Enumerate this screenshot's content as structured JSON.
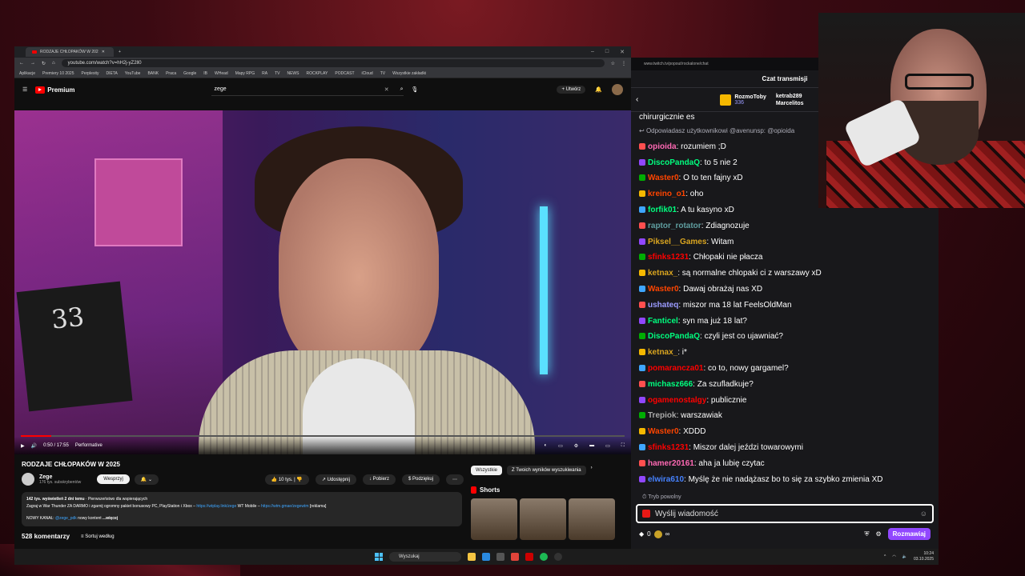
{
  "browser": {
    "tab_title": "RODZAJE CHŁOPAKÓW W 202",
    "url": "youtube.com/watch?v=hH2j-yZ2ll0",
    "bookmarks": [
      "Aplikacje",
      "Premiery 10 2025",
      "Perplexity",
      "DIETA",
      "YouTube",
      "BANK",
      "Praca",
      "Google",
      "IB",
      "WHead",
      "Mapy RPG",
      "RA",
      "TV",
      "NEWS",
      "ROCKPLAY",
      "PODCAST",
      "iCloud",
      "TV",
      "Wszystkie zakładki"
    ]
  },
  "youtube": {
    "logo_text": "Premium",
    "search_value": "zege",
    "create_label": "Utwórz",
    "player": {
      "time": "0:50 / 17:55",
      "chapter": "Performative",
      "progress": 0.05
    },
    "video_title": "RODZAJE CHŁOPAKÓW W 2025",
    "channel_name": "Zege",
    "channel_subs": "176 tys. subskrybentów",
    "support_label": "Wesprzyj",
    "likes": "10 tys.",
    "share_label": "Udostępnij",
    "download_label": "Pobierz",
    "thanks_label": "Podziękuj",
    "desc_stats": "142 tys. wyświetleń  2 dni temu",
    "desc_sponsor_note": "Pierwszeństwo dla wspierających",
    "desc_line1": "Zagraj w War Thunder ZA DARMO i zgarnij ogromny pakiet bonusowy PC, PlayStation i Xbox – ",
    "desc_link1": "https://wtplay.link/zege",
    "desc_line1b": "WT Mobile – ",
    "desc_link2": "https://wtm.gmae/zegewtm",
    "desc_line1c": " [reklama]",
    "desc_line2": "NOWY KANAŁ: ",
    "desc_link3": "@zege_pdk",
    "desc_line2b": " nowy kontent ",
    "desc_more": "...więcej",
    "comments_count": "528 komentarzy",
    "sort_label": "Sortuj według",
    "chip_all": "Wszystkie",
    "chip_results": "Z Twoich wyników wyszukiwania",
    "shorts_label": "Shorts"
  },
  "taskbar": {
    "search_placeholder": "Wyszukaj",
    "time": "10:24",
    "date": "03.10.2025"
  },
  "chat": {
    "popout_url": "www.twitch.tv/popout/rockalone/chat",
    "header": "Czat transmisji",
    "gift_user1": "RozmoToby",
    "gift_count1": "336",
    "gift_user2": "ketrab289",
    "gift_user3": "Marcelitos",
    "partial_msg": "chirurgicznie es",
    "reply_note": "Odpowiadasz użytkownikowi @avenunsp: @opioida",
    "messages": [
      {
        "user": "opioida",
        "text": ": rozumiem ;D",
        "color": "#ff69b4"
      },
      {
        "user": "DiscoPandaQ",
        "text": ": to 5 nie 2",
        "color": "#00ff7f"
      },
      {
        "user": "Waster0",
        "text": ": O to ten fajny xD",
        "color": "#ff4500"
      },
      {
        "user": "kreino_o1",
        "text": ": oho",
        "color": "#ff4500"
      },
      {
        "user": "forfik01",
        "text": ": A tu kasyno xD",
        "color": "#00ff7f"
      },
      {
        "user": "raptor_rotator",
        "text": ": Zdiagnozuje",
        "color": "#5f9ea0"
      },
      {
        "user": "Piksel__Games",
        "text": ": Witam",
        "color": "#daa520"
      },
      {
        "user": "sfinks1231",
        "text": ": Chłopaki nie płacza",
        "color": "#ff0000"
      },
      {
        "user": "ketnax_",
        "text": ": są normalne chlopaki ci z warszawy xD",
        "color": "#daa520"
      },
      {
        "user": "Waster0",
        "text": ": Dawaj obrażaj nas XD",
        "color": "#ff4500"
      },
      {
        "user": "ushateq",
        "text": ": miszor ma 18 lat FeelsOldMan",
        "color": "#9b9bff"
      },
      {
        "user": "Fanticel",
        "text": ": syn ma już 18 lat?",
        "color": "#00ff7f"
      },
      {
        "user": "DiscoPandaQ",
        "text": ": czyli jest co ujawniać?",
        "color": "#00ff7f"
      },
      {
        "user": "ketnax_",
        "text": ": i*",
        "color": "#daa520"
      },
      {
        "user": "pomarancza01",
        "text": ": co to, nowy gargamel?",
        "color": "#ff0000"
      },
      {
        "user": "michasz666",
        "text": ": Za szufladkuje?",
        "color": "#00ff7f"
      },
      {
        "user": "ogamenostalgy",
        "text": ": publicznie",
        "color": "#ff0000"
      },
      {
        "user": "Trepiok",
        "text": ": warszawiak",
        "color": "#a9a9a9"
      },
      {
        "user": "Waster0",
        "text": ": XDDD",
        "color": "#ff4500"
      },
      {
        "user": "sfinks1231",
        "text": ": Miszor dalej jeździ towarowymi",
        "color": "#ff0000"
      },
      {
        "user": "hamer20161",
        "text": ": aha ja lubię czytac",
        "color": "#ff69b4"
      },
      {
        "user": "elwira610",
        "text": ": Myślę że nie nadążasz bo to się za szybko zmienia XD",
        "color": "#4682ff"
      }
    ],
    "slow_mode": "Tryb powolny",
    "input_placeholder": "Wyślij wiadomość",
    "points": "0",
    "send_label": "Rozmawiaj"
  }
}
